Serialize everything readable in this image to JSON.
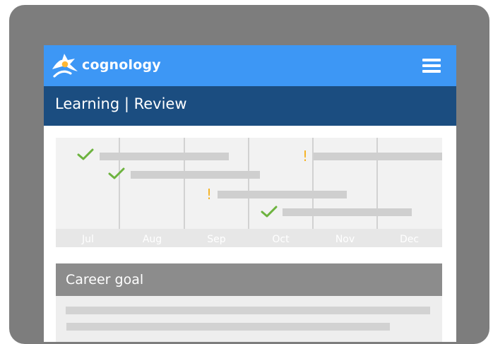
{
  "app": {
    "brand_name": "cognology",
    "menu_icon": "hamburger-menu-icon",
    "colors": {
      "top_bar": "#3d97f5",
      "title_bar": "#1b4d80",
      "device_frame": "#7d7d7d",
      "success": "#6db33f",
      "warning": "#f5b326"
    }
  },
  "header": {
    "title": "Learning | Review"
  },
  "timeline": {
    "months": [
      "Jul",
      "Aug",
      "Sep",
      "Oct",
      "Nov",
      "Dec"
    ],
    "items": [
      {
        "status": "complete",
        "icon": "check-icon"
      },
      {
        "status": "complete",
        "icon": "check-icon"
      },
      {
        "status": "warning",
        "icon": "exclamation-icon",
        "symbol": "!"
      },
      {
        "status": "complete",
        "icon": "check-icon"
      },
      {
        "status": "warning",
        "icon": "exclamation-icon",
        "symbol": "!"
      }
    ]
  },
  "career_goal": {
    "title": "Career goal"
  }
}
